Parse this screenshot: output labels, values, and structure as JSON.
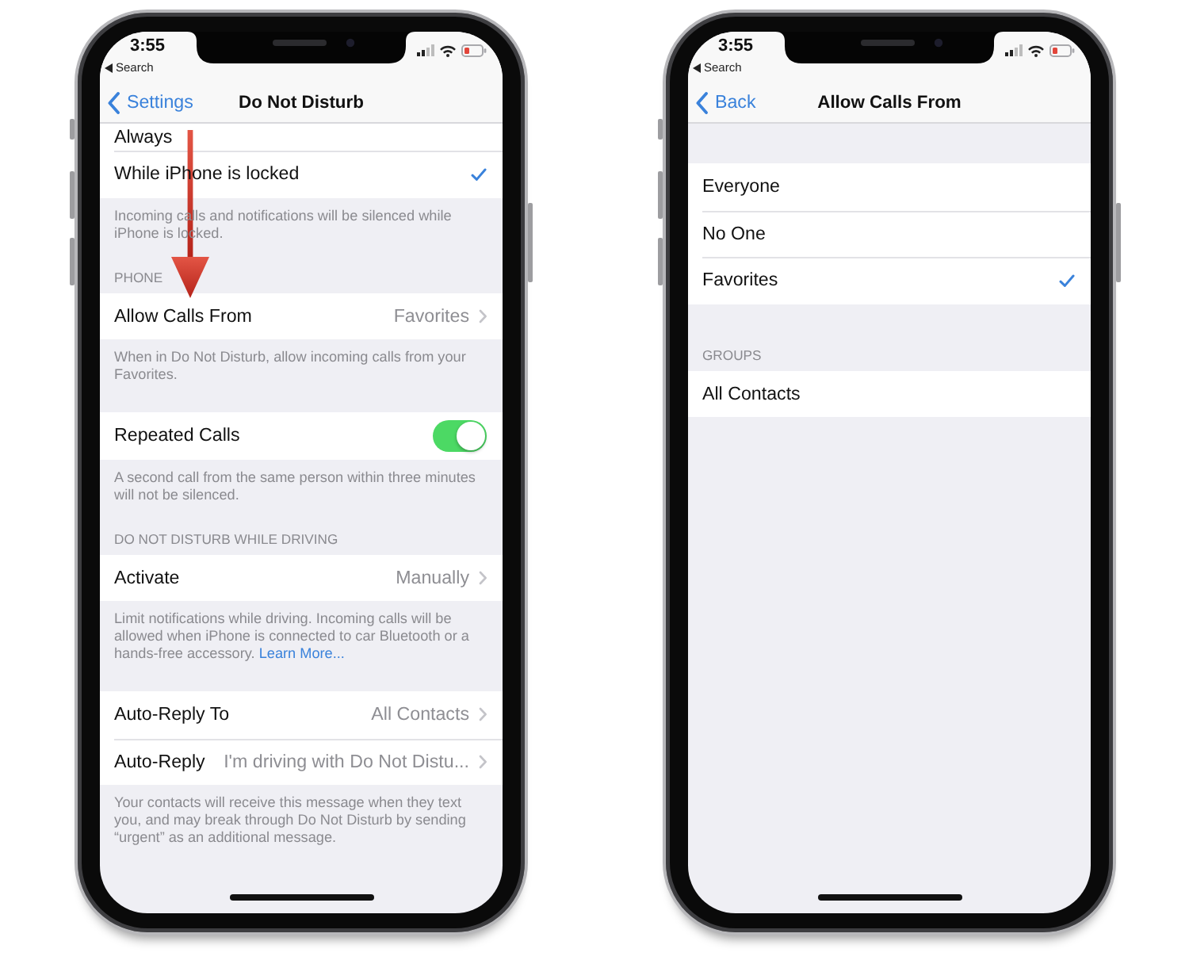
{
  "screens": [
    {
      "status_bar": {
        "time": "3:55",
        "back_link": "Search"
      },
      "nav": {
        "back": "Settings",
        "title": "Do Not Disturb"
      },
      "scrolled": true,
      "arrow": true,
      "sections": [
        {
          "rows": [
            {
              "kind": "option",
              "label": "Always",
              "selected": false
            },
            {
              "kind": "option",
              "label": "While iPhone is locked",
              "selected": true
            }
          ],
          "footer": "Incoming calls and notifications will be silenced while iPhone is locked."
        },
        {
          "header": "PHONE",
          "rows": [
            {
              "kind": "disclosure",
              "label": "Allow Calls From",
              "value": "Favorites"
            }
          ],
          "footer": "When in Do Not Disturb, allow incoming calls from your Favorites."
        },
        {
          "rows": [
            {
              "kind": "switch",
              "label": "Repeated Calls",
              "on": true
            }
          ],
          "footer": "A second call from the same person within three minutes will not be silenced."
        },
        {
          "header": "DO NOT DISTURB WHILE DRIVING",
          "rows": [
            {
              "kind": "disclosure",
              "label": "Activate",
              "value": "Manually"
            }
          ],
          "footer": "Limit notifications while driving. Incoming calls will be allowed when iPhone is connected to car Bluetooth or a hands-free accessory.",
          "footer_link": "Learn More..."
        },
        {
          "rows": [
            {
              "kind": "disclosure",
              "label": "Auto-Reply To",
              "value": "All Contacts"
            },
            {
              "kind": "disclosure",
              "label": "Auto-Reply",
              "value": "I'm driving with Do Not Distu..."
            }
          ],
          "footer": "Your contacts will receive this message when they text you, and may break through Do Not Disturb by sending “urgent” as an additional message."
        }
      ]
    },
    {
      "status_bar": {
        "time": "3:55",
        "back_link": "Search"
      },
      "nav": {
        "back": "Back",
        "title": "Allow Calls From"
      },
      "scrolled": false,
      "arrow": false,
      "sections": [
        {
          "rows": [
            {
              "kind": "option",
              "label": "Everyone",
              "selected": false
            },
            {
              "kind": "option",
              "label": "No One",
              "selected": false
            },
            {
              "kind": "option",
              "label": "Favorites",
              "selected": true
            }
          ]
        },
        {
          "header": "GROUPS",
          "rows": [
            {
              "kind": "option",
              "label": "All Contacts",
              "selected": false
            }
          ]
        }
      ]
    }
  ]
}
